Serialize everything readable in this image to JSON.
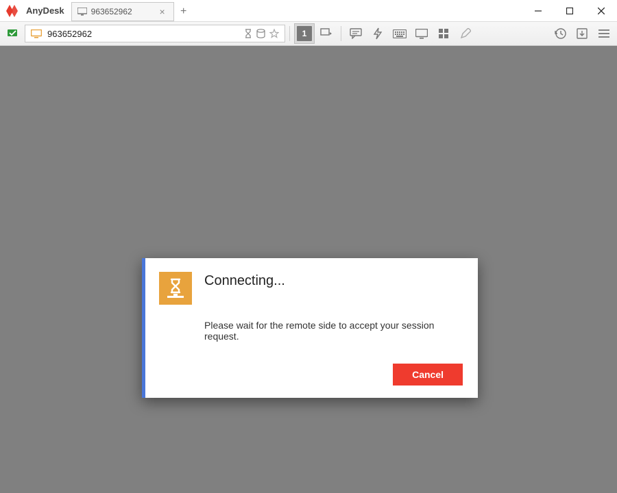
{
  "app": {
    "name": "AnyDesk"
  },
  "tabs": [
    {
      "label": "963652962"
    }
  ],
  "address": {
    "value": "963652962"
  },
  "toolbar": {
    "session_number": "1"
  },
  "dialog": {
    "title": "Connecting...",
    "message": "Please wait for the remote side to accept your session request.",
    "cancel": "Cancel"
  }
}
